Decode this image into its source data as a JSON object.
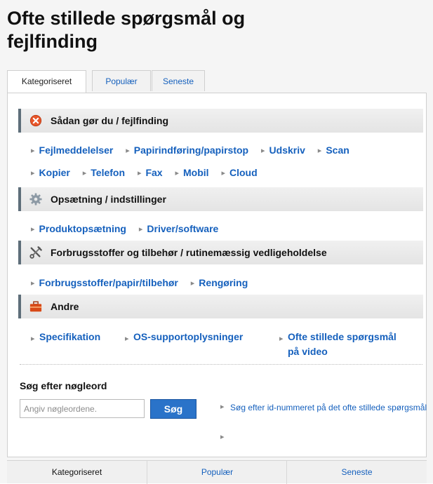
{
  "page_title": "Ofte stillede spørgsmål og fejlfinding",
  "tabs": [
    {
      "label": "Kategoriseret",
      "active": true
    },
    {
      "label": "Populær",
      "active": false
    },
    {
      "label": "Seneste",
      "active": false
    }
  ],
  "sections": [
    {
      "title": "Sådan gør du / fejlfinding",
      "icon": "error-circle-icon",
      "rows": [
        [
          "Fejlmeddelelser",
          "Papirindføring/papirstop",
          "Udskriv",
          "Scan"
        ],
        [
          "Kopier",
          "Telefon",
          "Fax",
          "Mobil",
          "Cloud"
        ]
      ]
    },
    {
      "title": "Opsætning / indstillinger",
      "icon": "gear-icon",
      "rows": [
        [
          "Produktopsætning",
          "Driver/software"
        ]
      ]
    },
    {
      "title": "Forbrugsstoffer og tilbehør / rutinemæssig vedligeholdelse",
      "icon": "tools-icon",
      "rows": [
        [
          "Forbrugsstoffer/papir/tilbehør",
          "Rengøring"
        ]
      ]
    },
    {
      "title": "Andre",
      "icon": "toolbox-icon",
      "links": [
        "Specifikation",
        "OS-supportoplysninger",
        "Ofte stillede spørgsmål på video"
      ]
    }
  ],
  "search": {
    "heading": "Søg efter nøgleord",
    "placeholder": "Angiv nøgleordene.",
    "button_label": "Søg",
    "id_link": "Søg efter id-nummeret på det ofte stillede spørgsmål"
  },
  "bottom_tabs": [
    {
      "label": "Kategoriseret",
      "active": true
    },
    {
      "label": "Populær",
      "active": false
    },
    {
      "label": "Seneste",
      "active": false
    }
  ],
  "colors": {
    "link": "#1560bd",
    "accent_button": "#2a73c9",
    "error_icon": "#e8562a"
  }
}
